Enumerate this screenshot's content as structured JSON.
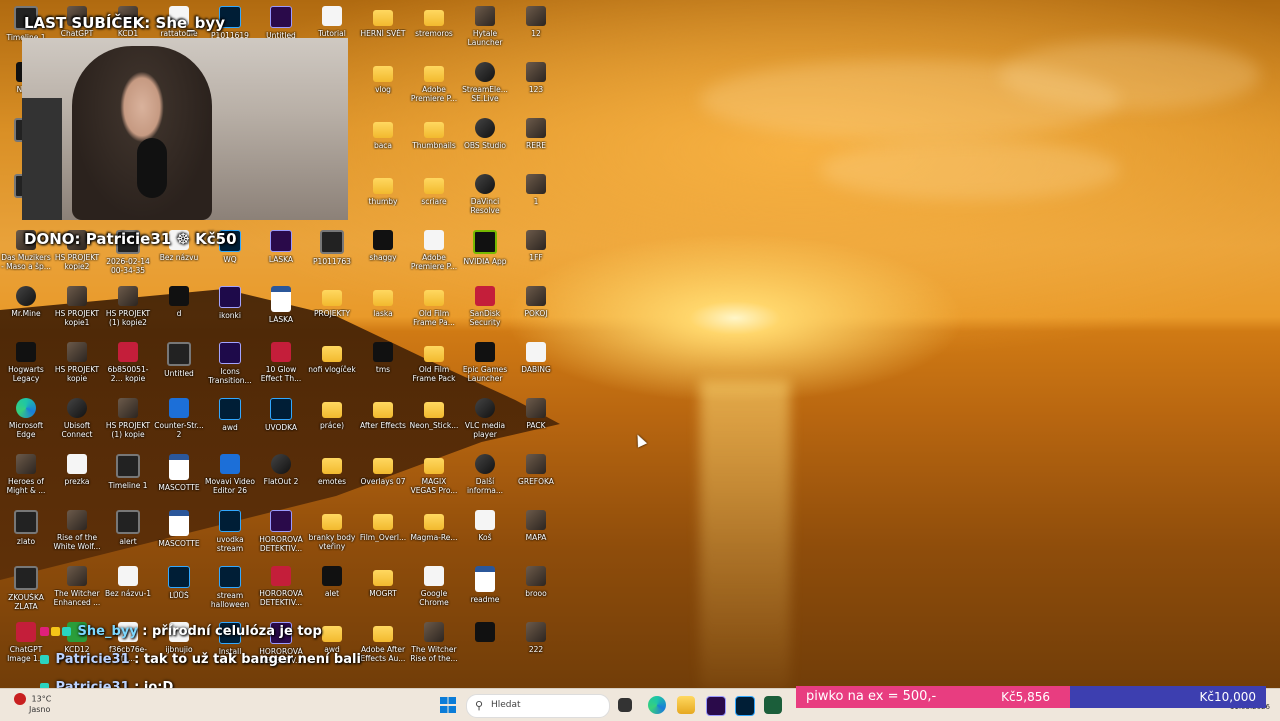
{
  "overlay": {
    "last_sub": "LAST SUBÍČEK: She_byy",
    "donation": "DONO: Patricie31 ☸ Kč50"
  },
  "chat": [
    {
      "user": "She_byy",
      "message": ": přírodní celulóza je top"
    },
    {
      "user": "Patricie31",
      "message": ": tak to už tak banger není bali"
    },
    {
      "user": "Patricie31",
      "message": ": jo:D"
    }
  ],
  "goal_bar": {
    "label": "piwko na ex = 500,-",
    "current": "Kč5,856",
    "target": "Kč10,000"
  },
  "taskbar": {
    "weather_temp": "13°C",
    "weather_text": "Jasno",
    "search_placeholder": "Hledat",
    "date": "11.03.2026"
  },
  "icons": {
    "c0": [
      "Timeline 1",
      "NADI",
      "",
      "",
      "Das Muzikers - Maso a šp...",
      "Mr.Mine",
      "Hogwarts Legacy",
      "Microsoft Edge",
      "Heroes of Might & ...",
      "zlato",
      "ZKOUŠKA ZLATA",
      "ChatGPT Image 1..."
    ],
    "c1": [
      "ChatGPT",
      "",
      "",
      "",
      "HS PROJEKT kopie2",
      "HS PROJEKT kopie1",
      "HS PROJEKT kopie",
      "Ubisoft Connect",
      "prezka",
      "Rise of the White Wolf...",
      "The Witcher Enhanced ...",
      "KCD12"
    ],
    "c2": [
      "KCD1",
      "",
      "",
      "",
      "2026-02-14 00-34-35",
      "HS PROJEKT (1) kopie2",
      "6b850051-2... kopie",
      "HS PROJEKT (1) kopie",
      "Timeline 1",
      "alert",
      "Bez názvu-1",
      "f36cb76e-fa..."
    ],
    "c3": [
      "rattatouie",
      "",
      "",
      "",
      "Bez názvu",
      "d",
      "Untitled",
      "Counter-Str... 2",
      "MASCOTTE",
      "MASCOTTE",
      "LŮŮŠ",
      "ijbnujio"
    ],
    "c4": [
      "P1011619",
      "",
      "",
      "",
      "WQ",
      "ikonki",
      "Icons Transition...",
      "awd",
      "Movavi Video Editor 26",
      "uvodka stream",
      "stream halloween",
      "Install"
    ],
    "c5": [
      "Untitled",
      "",
      "",
      "",
      "LÁSKA",
      "LÁSKA",
      "10 Glow Effect Th...",
      "UVODKA",
      "FlatOut 2",
      "HOROROVÁ DETEKTIV...",
      "HOROROVÁ DETEKTIV...",
      "HOROROVÁ DETEKTIV..."
    ],
    "c6": [
      "Tutorial",
      "",
      "",
      "",
      "P1011763",
      "PROJEKTY",
      "nofi vlogíček",
      "práce)",
      "emotes",
      "branky body vteřiny",
      "alet",
      "awd"
    ],
    "c7": [
      "HERNÍ SVĚT",
      "vlog",
      "baca",
      "thumby",
      "shaggy",
      "laska",
      "tms",
      "After Effects",
      "Overlays 07",
      "Film_Overl...",
      "MOGRT",
      "Adobe After Effects Au..."
    ],
    "c8": [
      "stremoros",
      "Adobe Premiere P...",
      "Thumbnails",
      "scriare",
      "Adobe Premiere P...",
      "Old Film Frame Pa...",
      "Old Film Frame Pack",
      "Neon_Stick...",
      "MAGIX VEGAS Pro...",
      "Magma-Re...",
      "Google Chrome",
      "The Witcher Rise of the..."
    ],
    "c9": [
      "Hytale Launcher",
      "StreamEle... SE.Live",
      "OBS Studio",
      "DaVinci Resolve",
      "NVIDIA App",
      "SanDisk Security",
      "Epic Games Launcher",
      "VLC media player",
      "Další informa...",
      "Koš",
      "readme",
      ""
    ],
    "c10": [
      "12",
      "123",
      "RERE",
      "1",
      "1FF",
      "POKOJ",
      "DABING",
      "PACK",
      "GREFOKA",
      "MAPA",
      "brooo",
      "222"
    ]
  },
  "icon_types": {
    "c0": [
      "film",
      "dark",
      "film",
      "film",
      "photo",
      "app",
      "dark",
      "edge",
      "photo",
      "film",
      "film",
      "red"
    ],
    "c1": [
      "photo",
      "dark",
      "dark",
      "dark",
      "photo",
      "photo",
      "photo",
      "app",
      "doc",
      "photo",
      "photo",
      "green"
    ],
    "c2": [
      "photo",
      "dark",
      "dark",
      "dark",
      "film",
      "photo",
      "red",
      "photo",
      "film",
      "film",
      "doc",
      "doc"
    ],
    "c3": [
      "doc",
      "dark",
      "dark",
      "dark",
      "doc",
      "dark",
      "film",
      "blue",
      "word",
      "word",
      "ps",
      "doc"
    ],
    "c4": [
      "ps",
      "dark",
      "dark",
      "dark",
      "ps",
      "ae",
      "ae",
      "ps",
      "blue",
      "ps",
      "ps",
      "ps"
    ],
    "c5": [
      "pr",
      "dark",
      "dark",
      "dark",
      "pr",
      "word",
      "red",
      "ps",
      "app",
      "pr",
      "red",
      "pr"
    ],
    "c6": [
      "doc",
      "dark",
      "dark",
      "dark",
      "film",
      "folder",
      "folder",
      "folder",
      "folder",
      "folder",
      "dark",
      "folder"
    ],
    "c7": [
      "folder",
      "folder",
      "folder",
      "folder",
      "dark",
      "folder",
      "dark",
      "folder",
      "folder",
      "folder",
      "folder",
      "folder"
    ],
    "c8": [
      "folder",
      "folder",
      "folder",
      "folder",
      "doc",
      "folder",
      "folder",
      "folder",
      "folder",
      "folder",
      "doc",
      "photo"
    ],
    "c9": [
      "photo",
      "app",
      "app",
      "app",
      "nv",
      "red",
      "dark",
      "app",
      "app",
      "doc",
      "word",
      "dark"
    ],
    "c10": [
      "photo",
      "photo",
      "photo",
      "photo",
      "photo",
      "photo",
      "doc",
      "photo",
      "photo",
      "photo",
      "photo",
      "photo"
    ]
  }
}
